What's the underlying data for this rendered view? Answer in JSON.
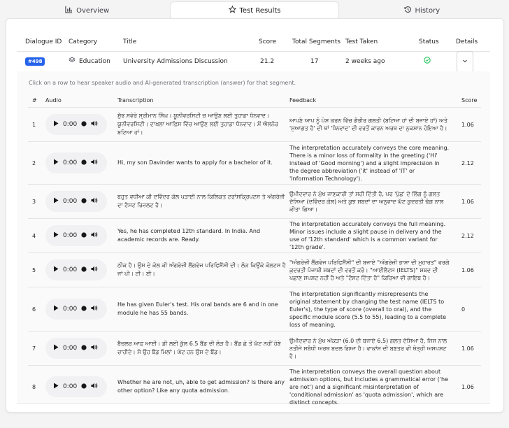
{
  "tabs": [
    {
      "label": "Overview",
      "icon": "bar-chart-icon"
    },
    {
      "label": "Test Results",
      "icon": "star-icon"
    },
    {
      "label": "History",
      "icon": "history-icon"
    }
  ],
  "results_table": {
    "headers": [
      "Dialogue ID",
      "Category",
      "Title",
      "Score",
      "Total Segments",
      "Test Taken",
      "Status",
      "Details"
    ],
    "row": {
      "id": "#498",
      "category": "Education",
      "category_icon": "layers-icon",
      "title": "University Admissions Discussion",
      "score": "21.2",
      "segments": "17",
      "taken": "2 weeks ago",
      "status_icon": "check-circle-icon",
      "status_color": "#22c55e",
      "details_icon": "chevron-down-icon"
    }
  },
  "segments": {
    "hint": "Click on a row to hear speaker audio and AI-generated transcription (answer) for that segment.",
    "headers": [
      "#",
      "Audio",
      "Transcription",
      "Feedback",
      "Score"
    ],
    "player_time": "0:00",
    "rows": [
      {
        "num": "1",
        "transcription": "ਸ਼ੁੱਭ ਸਵੇਰੇ ਸ੍ਰੀਮਾਨ ਸਿੰਘ। ਯੂਨੀਵਰਸਿਟੀ ਚ ਆਉਣ ਲਈ ਤੁਹਾਡਾ ਧੰਨਵਾਦ। ਯੂਨੀਵਰਸਿਟੀ। ਦਾਖ਼ਲਾ ਆਫ਼ਿਸ ਵਿੱਚ ਆਉਣ ਲਈ ਤੁਹਾਡਾ ਧੰਨਵਾਦ। ਮੈਂ ਐਲਨੋਰ ਬਟਿਆ ਹਾਂ।",
        "feedback": "ਆਪਣੇ ਆਪ ਨੂੰ ਪੇਸ਼ ਕਰਨ ਵਿੱਚ ਗੰਭੀਰ ਗਲਤੀ (ਬਟਿਆ ਹਾਂ ਦੀ ਬਜਾਏ ਹਾਂ) ਅਤੇ 'ਸੁਆਗਤ ਹੈ' ਦੀ ਥਾਂ 'ਧੰਨਵਾਦ' ਦੀ ਵਰਤੋਂ ਕਾਰਨ ਅਰਥ ਦਾ ਨੁਕਸਾਨ ਹੋਇਆ ਹੈ।",
        "score": "1.06"
      },
      {
        "num": "2",
        "transcription": "Hi, my son Davinder wants to apply for a bachelor of it.",
        "feedback": "The interpretation accurately conveys the core meaning. There is a minor loss of formality in the greeting ('Hi' instead of 'Good morning') and a slight imprecision in the degree abbreviation ('it' instead of 'IT' or 'Information Technology').",
        "score": "2.12"
      },
      {
        "num": "3",
        "transcription": "ਬਹੁਤ ਵਧੀਆ ਕੀ ਦਵਿੰਦਰ ਕੋਲ ਪੜਾਈ ਨਾਲ ਕਿਲਿਕਤ ਟਰਾਂਸਕ੍ਰਿਪਟਸ ਤੇ ਅੰਗਰੇਜ਼ੀ ਦਾ ਟੈਸਟ ਰਿਜ਼ਲਟ ਹੈ।",
        "feedback": "ਉਮੀਦਵਾਰ ਨੇ ਮੁੱਖ ਜਾਣਕਾਰੀ ਤਾਂ ਸਹੀ ਦਿੱਤੀ ਹੈ, ਪਰ 'ਪੁੱਛ' ਦੇ ਲਿੰਗ ਨੂੰ ਗਲਤ ਦੱਸਿਆ (ਦਵਿੰਦਰ ਕੋਲ) ਅਤੇ ਕੁਝ ਸ਼ਬਦਾਂ ਦਾ ਅਨੁਵਾਦ ਘੱਟ ਕੁਦਰਤੀ ਢੰਗ ਨਾਲ ਕੀਤਾ ਗਿਆ।",
        "score": "1.06"
      },
      {
        "num": "4",
        "transcription": "Yes, he has completed 12th standard. In India. And academic records are. Ready.",
        "feedback": "The interpretation accurately conveys the full meaning. Minor issues include a slight pause in delivery and the use of '12th standard' which is a common variant for '12th grade'.",
        "score": "2.12"
      },
      {
        "num": "5",
        "transcription": "ਠੀਕ ਹੈ। ਉਸ ਦੇ ਕੋਲ ਕੀ ਅੰਗਰੇਜ਼ੀ ਲੈਂਗਵੇਜ ਪਰਿਫਿਸ਼ੈਂਸੀ ਦੀ। ਲੋੜ ਕਿਉਂਕੇ ਕੋਲਟਸ ਹੈ ਜਾਂ ਪੀ। ਟੀ। ਈ।",
        "feedback": "\"ਅੰਗਰੇਜ਼ੀ ਲੈਂਗਵੇਜ ਪਰਿਫਿਸ਼ੈਂਸੀ\" ਦੀ ਬਜਾਏ \"ਅੰਗਰੇਜ਼ੀ ਭਾਸ਼ਾ ਦੀ ਮੁਹਾਰਤ\" ਵਰਗੇ ਕੁਦਰਤੀ ਪੰਜਾਬੀ ਸ਼ਬਦਾਂ ਦੀ ਵਰਤੋਂ ਕਰੋ। \"ਆਈਲੈਟਸ (IELTS)\" ਸ਼ਬਦ ਦੀ ਪਛਾਣ ਸਪਸ਼ਟ ਨਹੀਂ ਹੈ ਅਤੇ \"ਟੈਸਟ ਦਿੱਤਾ ਹੈ\" ਕਿਰਿਆ ਵੀ ਗਾਇਬ ਹੈ।",
        "score": "1.06"
      },
      {
        "num": "6",
        "transcription": "He has given Euler's test. His oral bands are 6 and in one module he has 55 bands.",
        "feedback": "The interpretation significantly misrepresents the original statement by changing the test name (IELTS to Euler's), the type of score (overall to oral), and the specific module score (5.5 to 55), leading to a complete loss of meaning.",
        "score": "0"
      },
      {
        "num": "7",
        "transcription": "ਬੈਚਲਰ ਆਫ਼ ਆਈ। ਡੀ ਲਈ ਕੁੱਲ 6.5 ਬੈਂਡ ਦੀ ਲੋੜ ਹੈ। ਬੈਂਡ ਛੇ ਤੋਂ ਘੱਟ ਨਹੀਂ ਹੋਣੇ ਚਾਹੀਦੇ। ਸੋ ਉਹ ਬੈਂਡ ਮਿਲਾਂ। ਘੱਟ ਹਨ ਉਸ ਦੇ ਬੈਂਡ।",
        "feedback": "ਉਮੀਦਵਾਰ ਨੇ ਮੁੱਖ ਅੰਕੜਾ (6.0 ਦੀ ਬਜਾਏ 6.5) ਗਲਤ ਦੱਸਿਆ ਹੈ, ਜਿਸ ਨਾਲ ਨਤੀਜੇ ਸਬੰਧੀ ਅਰਥ ਬਦਲ ਗਿਆ ਹੈ। ਵਾਕਾਂਸ਼ ਦੀ ਬਣਤਰ ਵੀ ਥੋੜ੍ਹੀ ਅਸਪਸ਼ਟ ਹੈ।",
        "score": "1.06"
      },
      {
        "num": "8",
        "transcription": "Whether he are not, uh, able to get admission? Is there any other option? Like any quota admission.",
        "feedback": "The interpretation conveys the overall question about admission options, but includes a grammatical error ('he are not') and a significant misinterpretation of 'conditional admission' as 'quota admission', which are distinct concepts.",
        "score": "1.06"
      }
    ]
  }
}
